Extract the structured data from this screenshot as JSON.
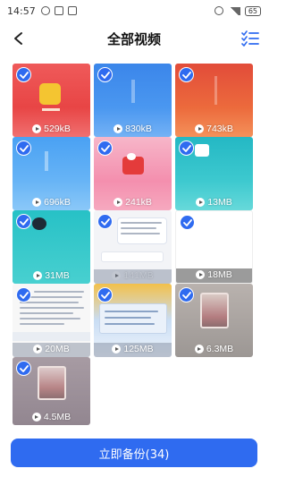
{
  "status_bar": {
    "time": "14:57",
    "battery": "65"
  },
  "header": {
    "title": "全部视频"
  },
  "videos": [
    {
      "size": "529kB"
    },
    {
      "size": "830kB"
    },
    {
      "size": "743kB"
    },
    {
      "size": "696kB"
    },
    {
      "size": "241kB"
    },
    {
      "size": "13MB"
    },
    {
      "size": "31MB"
    },
    {
      "size": "141MB"
    },
    {
      "size": "18MB"
    },
    {
      "size": "20MB"
    },
    {
      "size": "125MB"
    },
    {
      "size": "6.3MB"
    },
    {
      "size": "4.5MB"
    }
  ],
  "footer": {
    "backup_label": "立即备份(34)"
  },
  "colors": {
    "accent": "#2f6bf0"
  }
}
